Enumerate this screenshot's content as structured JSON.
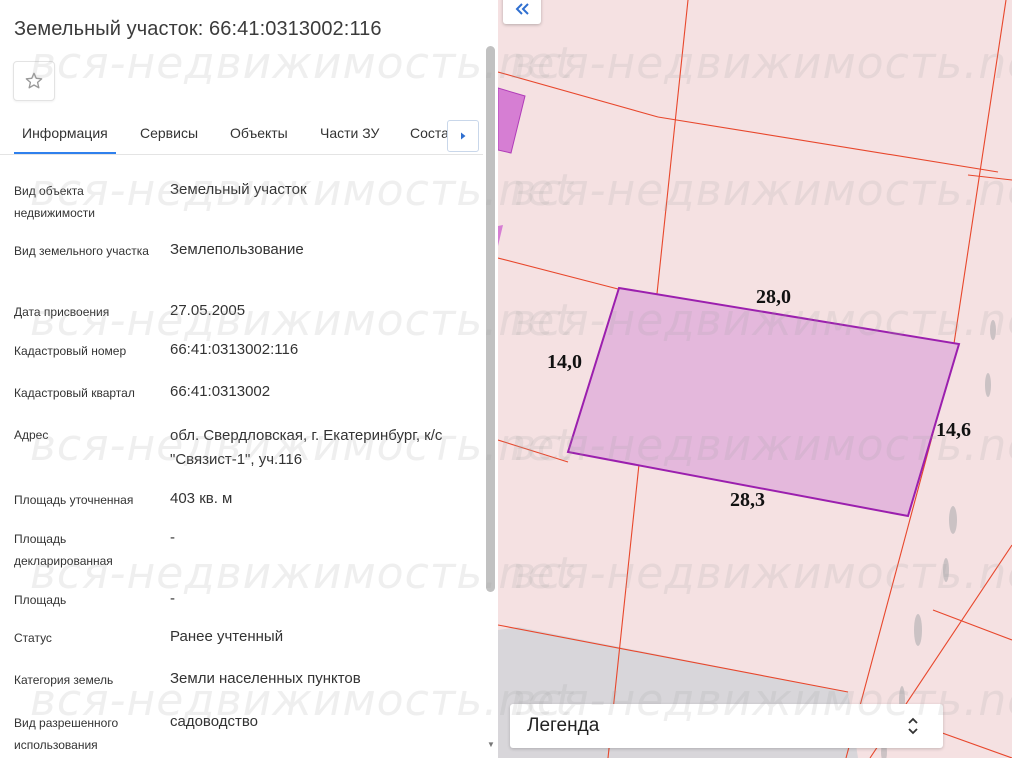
{
  "header": {
    "title": "Земельный участок: 66:41:0313002:116",
    "favorite_icon": "star-outline-icon"
  },
  "tabs": [
    {
      "label": "Информация",
      "active": true
    },
    {
      "label": "Сервисы",
      "active": false
    },
    {
      "label": "Объекты",
      "active": false
    },
    {
      "label": "Части ЗУ",
      "active": false
    },
    {
      "label": "Соста",
      "active": false
    }
  ],
  "tab_scroll_icon": "caret-right-icon",
  "info": [
    {
      "label": "Вид объекта недвижимости",
      "value": "Земельный участок"
    },
    {
      "label": "Вид земельного участка",
      "value": "Землепользование"
    },
    {
      "label": "Дата присвоения",
      "value": "27.05.2005"
    },
    {
      "label": "Кадастровый номер",
      "value": "66:41:0313002:116"
    },
    {
      "label": "Кадастровый квартал",
      "value": "66:41:0313002"
    },
    {
      "label": "Адрес",
      "value": "обл. Свердловская, г. Екатеринбург, к/с \"Связист-1\", уч.116"
    },
    {
      "label": "Площадь уточненная",
      "value": "403 кв. м"
    },
    {
      "label": "Площадь декларированная",
      "value": "-"
    },
    {
      "label": "Площадь",
      "value": "-"
    },
    {
      "label": "Статус",
      "value": "Ранее учтенный"
    },
    {
      "label": "Категория земель",
      "value": "Земли населенных пунктов"
    },
    {
      "label": "Вид разрешенного использования",
      "value": "садоводство"
    }
  ],
  "map": {
    "collapse_icon": "double-chevron-left-icon",
    "dimensions": {
      "top": "28,0",
      "left": "14,0",
      "right": "14,6",
      "bottom": "28,3"
    },
    "colors": {
      "background": "#f5e1e2",
      "boundary": "#e8472c",
      "parcel_fill": "#e4b8dc",
      "parcel_stroke": "#9b1fae",
      "neighbor_fill": "#d67ed3",
      "road": "#d7d5d9"
    },
    "legend": {
      "title": "Легенда",
      "icon": "sort-arrows-icon"
    }
  },
  "watermark": "вся-недвижимость.net"
}
